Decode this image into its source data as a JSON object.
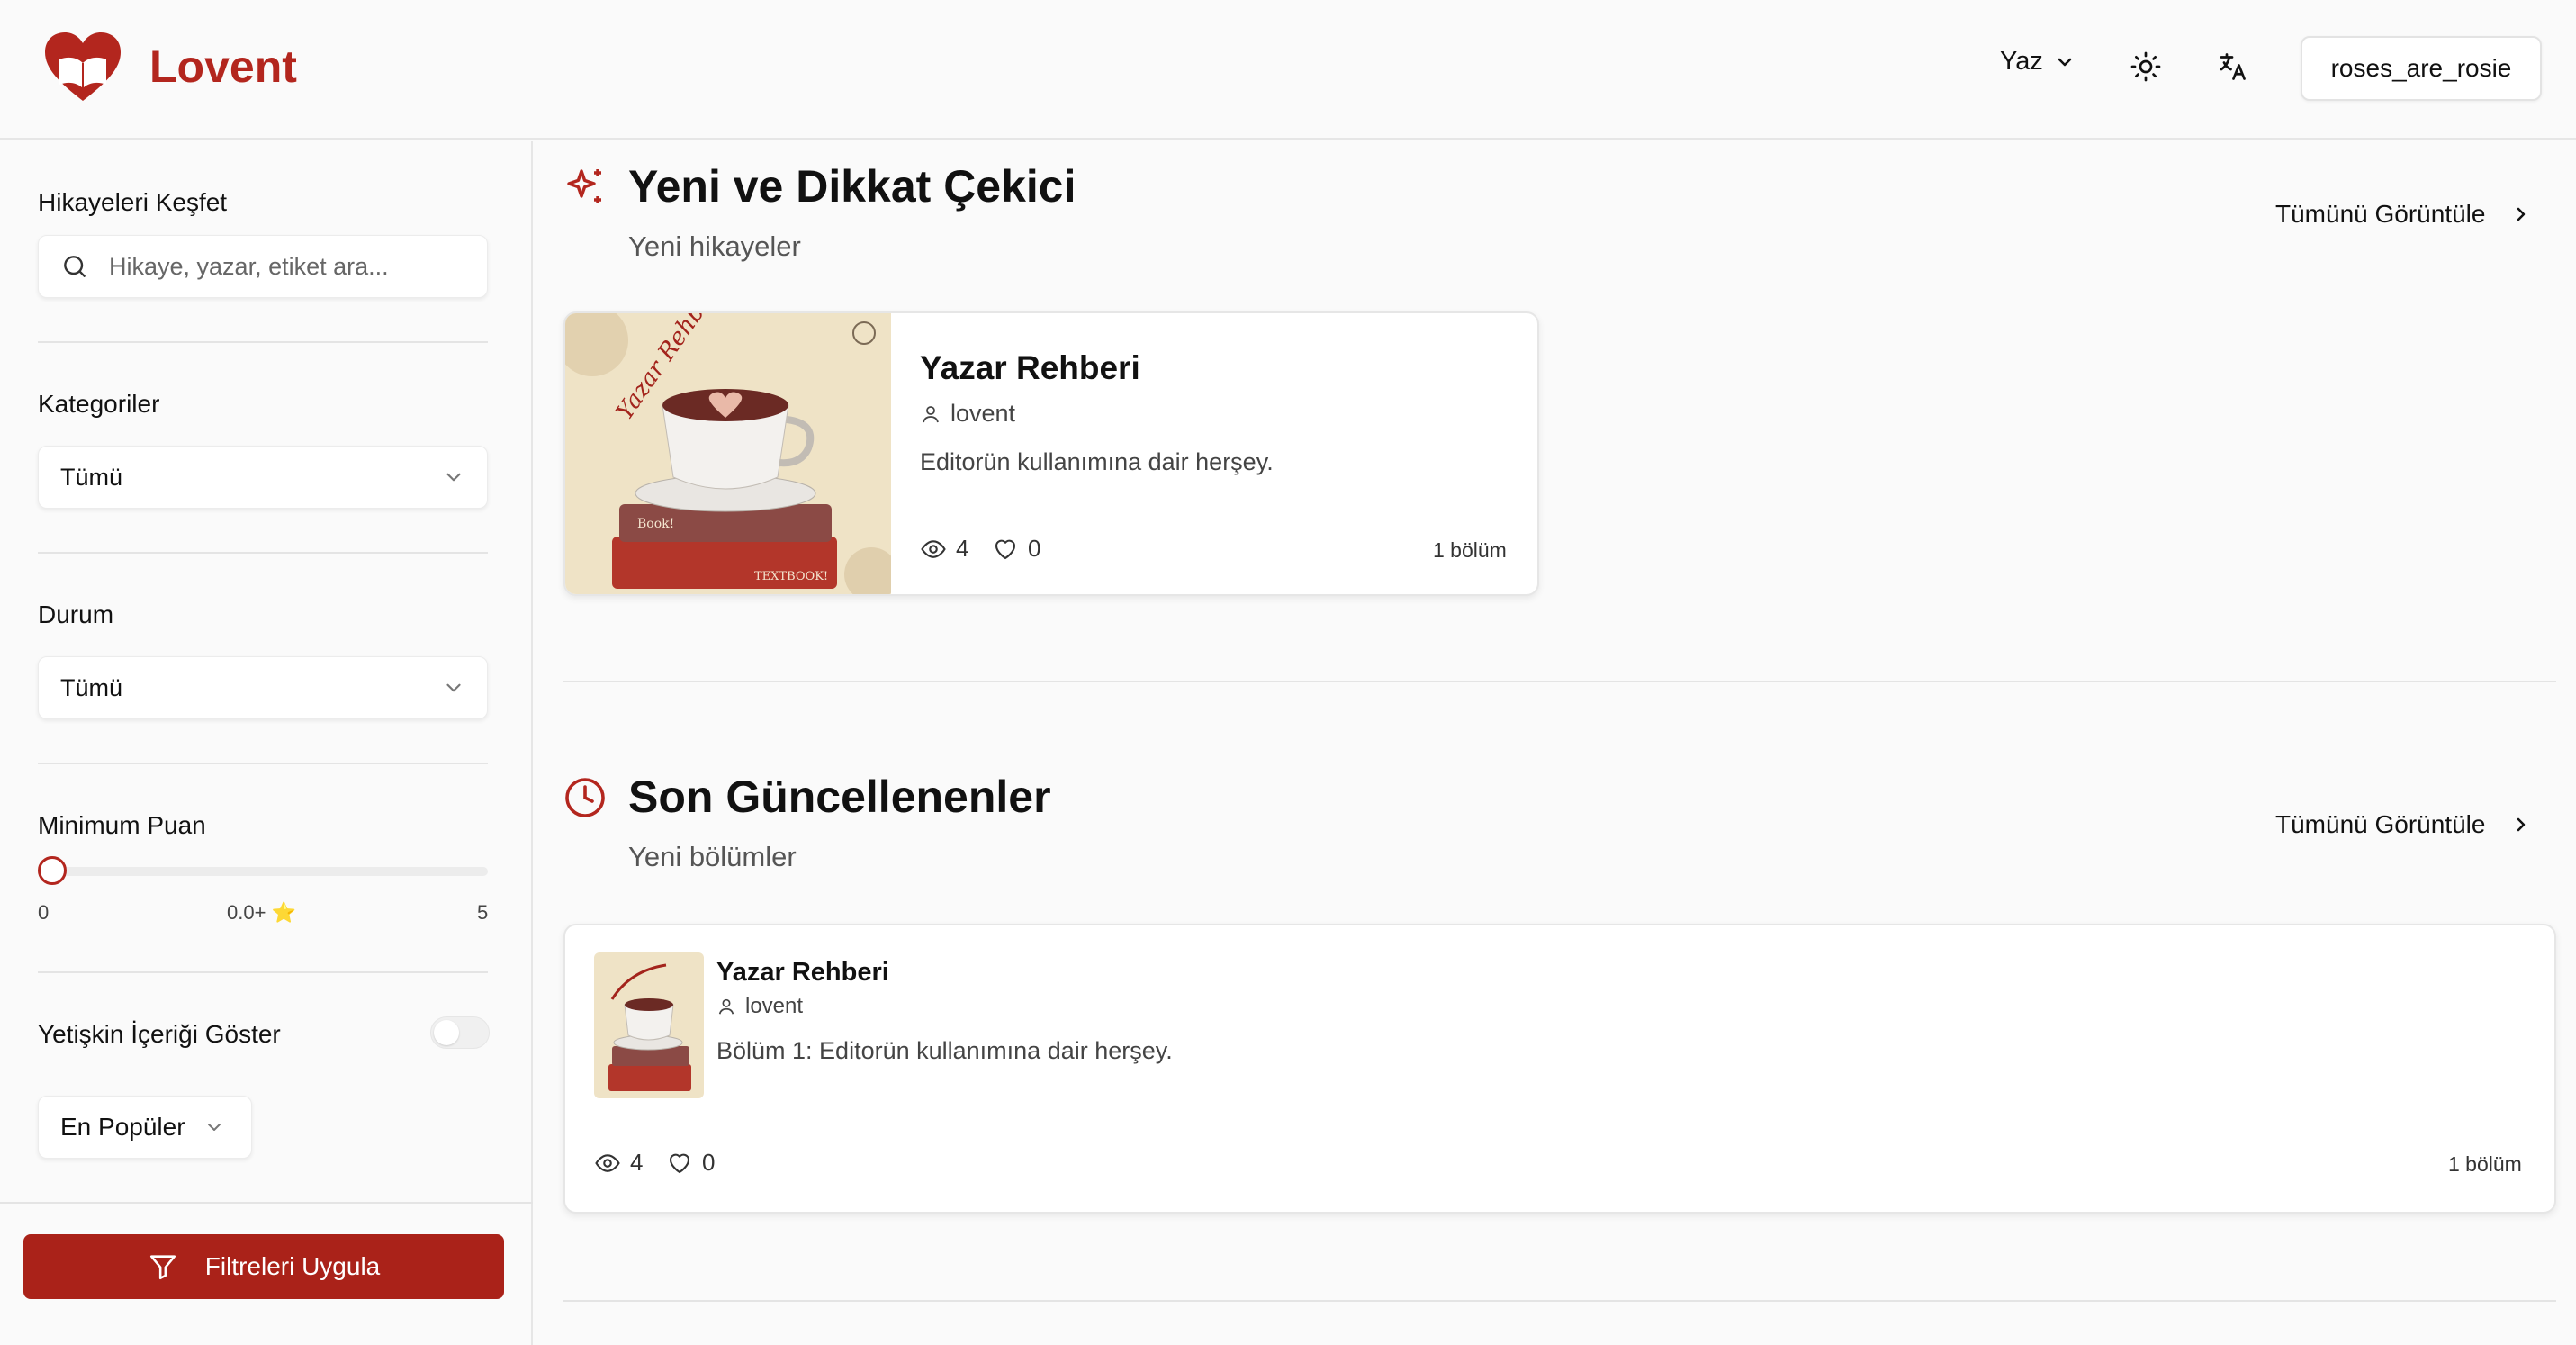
{
  "app": {
    "name": "Lovent",
    "brand_color": "#b3261e"
  },
  "header": {
    "write_label": "Yaz",
    "username": "roses_are_rosie"
  },
  "sidebar": {
    "discover_label": "Hikayeleri Keşfet",
    "search_placeholder": "Hikaye, yazar, etiket ara...",
    "categories_label": "Kategoriler",
    "categories_value": "Tümü",
    "status_label": "Durum",
    "status_value": "Tümü",
    "min_rating_label": "Minimum Puan",
    "rating_min": "0",
    "rating_current": "0.0+ ⭐",
    "rating_max": "5",
    "rating_value": 0,
    "adult_label": "Yetişkin İçeriği Göster",
    "adult_enabled": false,
    "sort_value": "En Popüler",
    "apply_label": "Filtreleri Uygula"
  },
  "sections": [
    {
      "title": "Yeni ve Dikkat Çekici",
      "subtitle": "Yeni hikayeler",
      "view_all": "Tümünü Görüntüle",
      "story": {
        "title": "Yazar Rehberi",
        "author": "lovent",
        "description": "Editorün kullanımına dair herşey.",
        "views": "4",
        "likes": "0",
        "chapters": "1 bölüm",
        "cover_text_top": "Yazar Rehberi -Writer's Guide",
        "cover_text_book": "Book!",
        "cover_text_textbook": "TEXTBOOK!"
      }
    },
    {
      "title": "Son Güncellenenler",
      "subtitle": "Yeni bölümler",
      "view_all": "Tümünü Görüntüle",
      "story": {
        "title": "Yazar Rehberi",
        "author": "lovent",
        "chapter_line": "Bölüm 1: Editorün kullanımına dair herşey.",
        "views": "4",
        "likes": "0",
        "chapters": "1 bölüm"
      }
    }
  ]
}
